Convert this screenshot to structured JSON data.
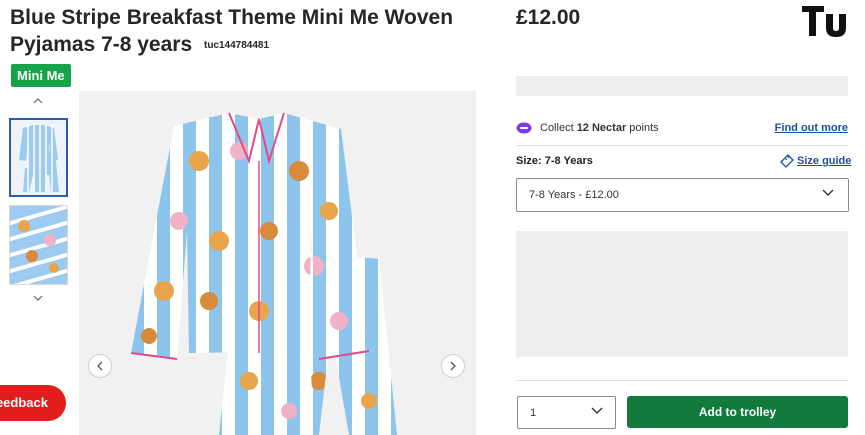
{
  "product": {
    "title": "Blue Stripe Breakfast Theme Mini Me Woven Pyjamas 7-8 years",
    "code": "tuc144784481",
    "badge": "Mini Me",
    "price": "£12.00"
  },
  "brand": {
    "logo_text": "Tu"
  },
  "nectar": {
    "prefix": "Collect",
    "points": "12 Nectar",
    "suffix": "points",
    "find_out_more": "Find out more"
  },
  "size": {
    "label": "Size: 7-8 Years",
    "guide_label": "Size guide",
    "selected": "7-8 Years - £12.00"
  },
  "quantity": {
    "selected": "1"
  },
  "actions": {
    "add_to_trolley": "Add to trolley"
  },
  "feedback": {
    "label": "Feedback"
  },
  "gallery": {
    "thumbnail_count": 2,
    "selected_index": 0
  },
  "colors": {
    "badge_green": "#16a34a",
    "add_button_green": "#137a3e",
    "feedback_red": "#e11d1d",
    "link_blue": "#1d4fa0",
    "stripe_blue": "#8cc4ec",
    "nectar_purple": "#7c3aed"
  },
  "icons": [
    "chevron-up-icon",
    "chevron-down-icon",
    "chevron-left-icon",
    "chevron-right-icon",
    "nectar-icon",
    "ruler-icon"
  ]
}
